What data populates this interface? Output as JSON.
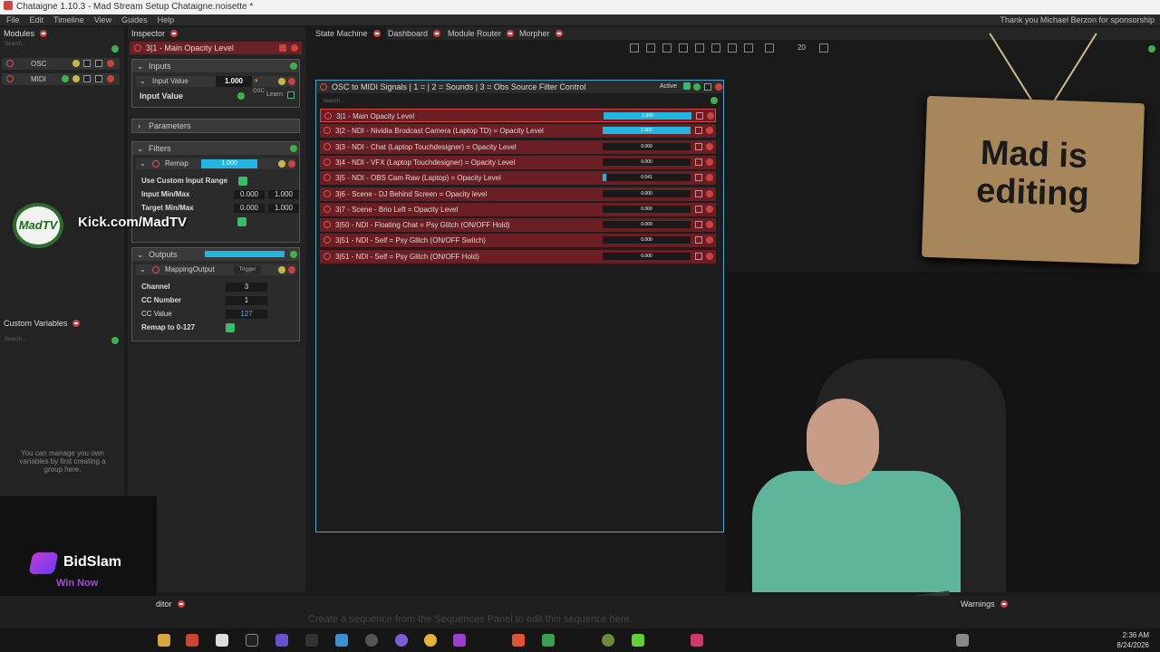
{
  "window": {
    "title": "Chataigne 1.10.3 - Mad Stream Setup Chataigne.noisette *",
    "thanks": "Thank you Michael Berzon for sponsorship"
  },
  "menu": [
    "File",
    "Edit",
    "Timeline",
    "View",
    "Guides",
    "Help"
  ],
  "modules": {
    "title": "Modules",
    "search": "Search...",
    "items": [
      {
        "label": "OSC"
      },
      {
        "label": "MIDI"
      }
    ]
  },
  "custom_vars": {
    "title": "Custom Variables",
    "search": "Search...",
    "help": "You can manage you own variables by first creating a group here."
  },
  "inspector": {
    "title": "Inspector",
    "header": "3|1 - Main Opacity Level",
    "inputs": {
      "label": "Inputs",
      "input_value_label": "Input Value",
      "input_value": "1.000",
      "value_row": "Input Value",
      "osc": "OSC",
      "learn": "Learn"
    },
    "parameters": "Parameters",
    "filters": {
      "label": "Filters",
      "remap": "Remap",
      "remap_val": "1.000",
      "custom_range": "Use Custom Input Range",
      "in_minmax": "Input Min/Max",
      "in_min": "0.000",
      "in_max": "1.000",
      "target_minmax": "Target Min/Max",
      "t_min": "0.000",
      "t_max": "1.000"
    },
    "outputs": {
      "label": "Outputs",
      "mapping": "MappingOutput",
      "trigger": "Trigger",
      "channel_label": "Channel",
      "channel": "3",
      "cc_label": "CC Number",
      "cc": "1",
      "ccv_label": "CC Value",
      "ccv": "127",
      "remap_label": "Remap to 0-127"
    }
  },
  "tabs": [
    "State Machine",
    "Dashboard",
    "Module Router",
    "Morpher"
  ],
  "toolbar": {
    "zoom": "20"
  },
  "osc_window": {
    "title": "OSC to MIDI Signals | 1 =  | 2 = Sounds | 3 = Obs Source Filter Control",
    "active": "Active",
    "search": "Search...",
    "rows": [
      {
        "label": "3|1 - Main Opacity Level",
        "value": "1.000",
        "fill": 1.0
      },
      {
        "label": "3|2 - NDI - Nividia Brodcast Camera (Laptop TD) = Opacity Level",
        "value": "1.000",
        "fill": 1.0
      },
      {
        "label": "3|3 - NDI - Chat (Laptop Touchdesigner) = Opacity Level",
        "value": "0.000",
        "fill": 0
      },
      {
        "label": "3|4 - NDI - VFX (Laptop Touchdesigner) = Opacity Level",
        "value": "0.000",
        "fill": 0
      },
      {
        "label": "3|5 - NDI - OBS Cam Raw (Laptop) = Opacity Level",
        "value": "0.041",
        "fill": 0.041
      },
      {
        "label": "3|6 - Scene - DJ Behind Screen = Opacity level",
        "value": "0.000",
        "fill": 0
      },
      {
        "label": "3|7 - Scene - Brio Left = Opacity Level",
        "value": "0.000",
        "fill": 0
      },
      {
        "label": "3|50 - NDI - Floating Chat = Psy Glitch (ON/OFF Hold)",
        "value": "0.000",
        "fill": 0
      },
      {
        "label": "3|51 - NDI - Self = Psy Glitch (ON/OFF Switch)",
        "value": "0.000",
        "fill": 0
      },
      {
        "label": "3|51 - NDI - Self = Psy Glitch (ON/OFF Hold)",
        "value": "0.000",
        "fill": 0
      }
    ]
  },
  "overlay": {
    "sign_line1": "Mad is",
    "sign_line2": "editing",
    "madtv": "MadTV",
    "kick": "Kick.com/MadTV",
    "bidslam": "BidSlam",
    "win_now": "Win Now"
  },
  "bottom": {
    "editor": "ditor",
    "warnings": "Warnings",
    "hint": "Create a sequence from the Sequences Panel to edit this sequence here."
  },
  "clock": {
    "time": "2:36 AM",
    "date": "8/24/2026"
  }
}
